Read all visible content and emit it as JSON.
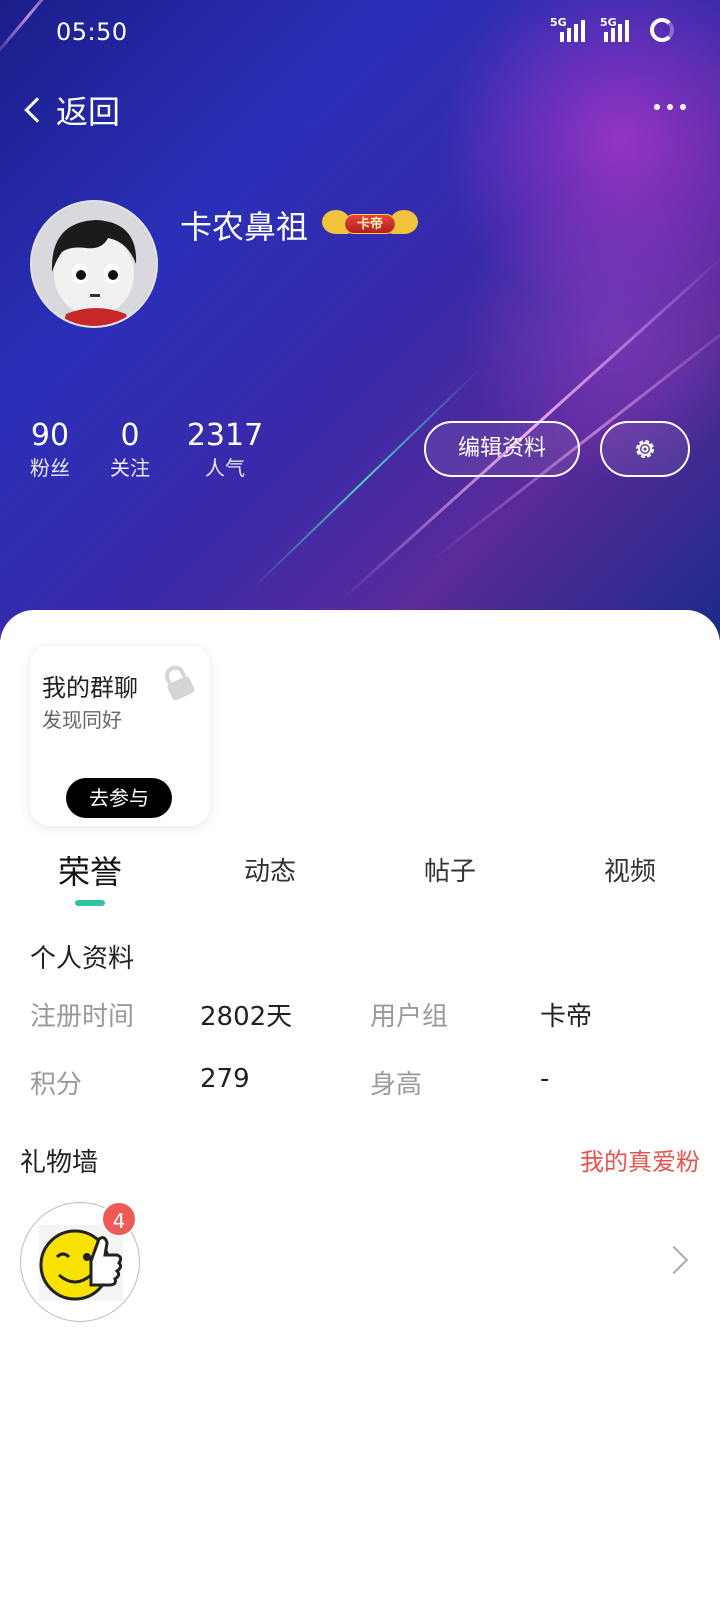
{
  "status_bar": {
    "time": "05:50",
    "net1": "5G",
    "net2": "5G"
  },
  "nav": {
    "back_label": "返回"
  },
  "profile": {
    "username": "卡农鼻祖",
    "badge_text": "卡帝"
  },
  "stats": [
    {
      "value": "90",
      "label": "粉丝"
    },
    {
      "value": "0",
      "label": "关注"
    },
    {
      "value": "2317",
      "label": "人气"
    }
  ],
  "actions": {
    "edit_label": "编辑资料"
  },
  "group_card": {
    "title": "我的群聊",
    "subtitle": "发现同好",
    "button": "去参与"
  },
  "tabs": [
    {
      "label": "荣誉",
      "active": true
    },
    {
      "label": "动态",
      "active": false
    },
    {
      "label": "帖子",
      "active": false
    },
    {
      "label": "视频",
      "active": false
    }
  ],
  "personal_info": {
    "title": "个人资料",
    "fields": [
      {
        "label": "注册时间",
        "value": "2802天"
      },
      {
        "label": "用户组",
        "value": "卡帝"
      },
      {
        "label": "积分",
        "value": "279"
      },
      {
        "label": "身高",
        "value": "-"
      }
    ]
  },
  "gift_wall": {
    "title": "礼物墙",
    "link": "我的真爱粉",
    "gift_count": "4"
  },
  "colors": {
    "accent": "#2fc2a4",
    "link_red": "#e9524e",
    "badge_red": "#ee5a55"
  }
}
